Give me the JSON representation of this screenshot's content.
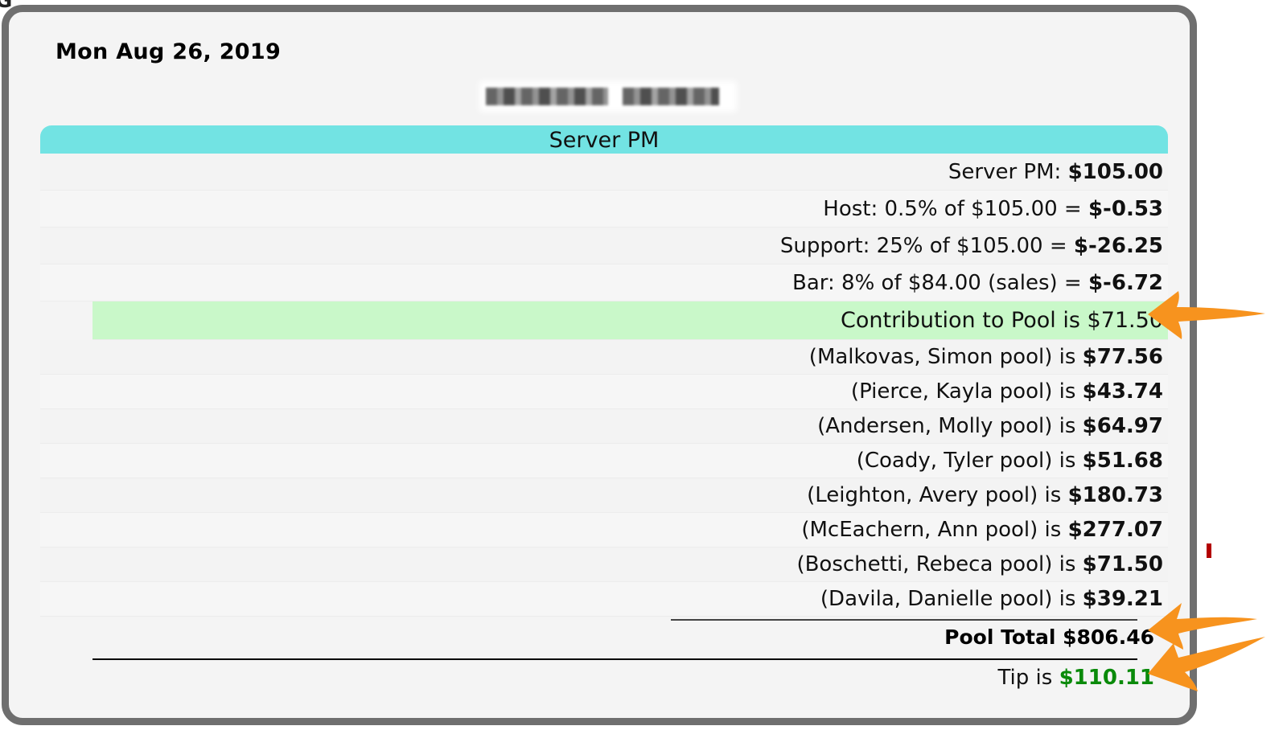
{
  "date": "Mon Aug 26, 2019",
  "section_title": "Server PM",
  "lines": [
    {
      "label": "Server PM: ",
      "amount": "$105.00"
    },
    {
      "label": "Host: 0.5% of $105.00 = ",
      "amount": "$-0.53"
    },
    {
      "label": "Support: 25% of $105.00 = ",
      "amount": "$-26.25"
    },
    {
      "label": "Bar: 8% of $84.00 (sales) = ",
      "amount": "$-6.72"
    }
  ],
  "contribution": "Contribution to Pool is $71.50",
  "pools": [
    {
      "label": "(Malkovas, Simon pool) is ",
      "amount": "$77.56"
    },
    {
      "label": "(Pierce, Kayla pool) is ",
      "amount": "$43.74"
    },
    {
      "label": "(Andersen, Molly pool) is ",
      "amount": "$64.97"
    },
    {
      "label": "(Coady, Tyler pool) is ",
      "amount": "$51.68"
    },
    {
      "label": "(Leighton, Avery pool) is ",
      "amount": "$180.73"
    },
    {
      "label": "(McEachern, Ann pool) is ",
      "amount": "$277.07"
    },
    {
      "label": "(Boschetti, Rebeca pool) is ",
      "amount": "$71.50"
    },
    {
      "label": "(Davila, Danielle pool) is ",
      "amount": "$39.21"
    }
  ],
  "pool_total": "Pool Total $806.46",
  "tip": {
    "label": "Tip is ",
    "amount": "$110.11"
  },
  "colors": {
    "header": "#72e3e3",
    "highlight": "#c9f8c9",
    "tip_amount": "#0a8a0a",
    "arrow": "#f7931e",
    "frame": "#6f6f6f"
  }
}
